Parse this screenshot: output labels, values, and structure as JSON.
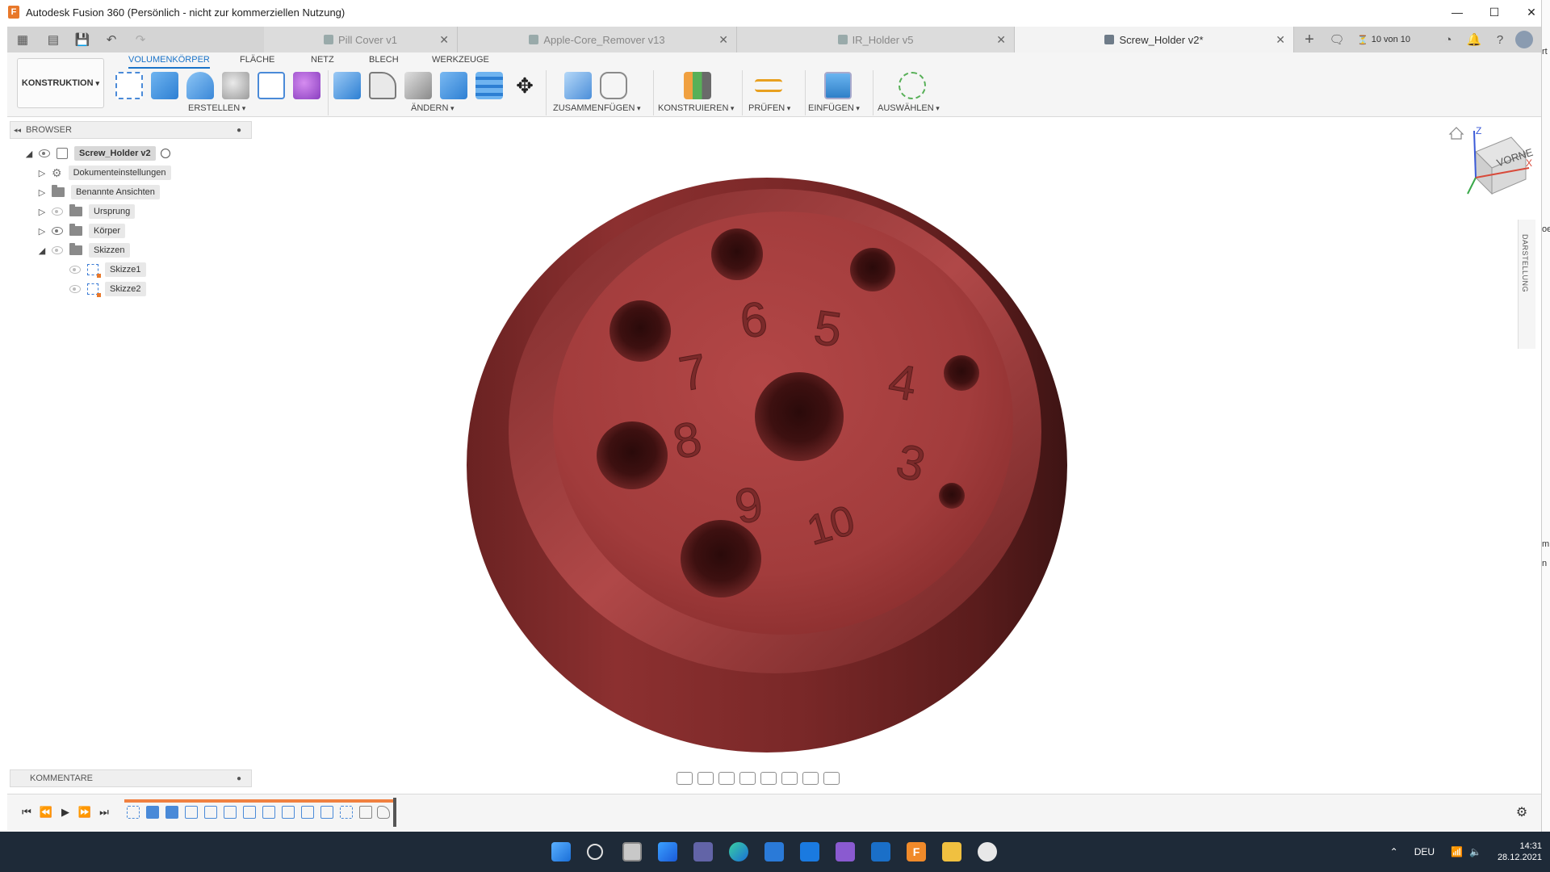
{
  "window": {
    "title": "Autodesk Fusion 360 (Persönlich - nicht zur kommerziellen Nutzung)",
    "logo_letter": "F"
  },
  "tabs": [
    {
      "label": "Pill Cover v1",
      "active": false
    },
    {
      "label": "Apple-Core_Remover v13",
      "active": false
    },
    {
      "label": "IR_Holder v5",
      "active": false
    },
    {
      "label": "Screw_Holder v2*",
      "active": true
    }
  ],
  "tabbar": {
    "job_count": "10 von 10"
  },
  "toolbar": {
    "workspace": "KONSTRUKTION",
    "ribbon_tabs": [
      "VOLUMENKÖRPER",
      "FLÄCHE",
      "NETZ",
      "BLECH",
      "WERKZEUGE"
    ],
    "groups": [
      "ERSTELLEN",
      "ÄNDERN",
      "ZUSAMMENFÜGEN",
      "KONSTRUIEREN",
      "PRÜFEN",
      "EINFÜGEN",
      "AUSWÄHLEN"
    ]
  },
  "browser": {
    "title": "BROWSER",
    "root": "Screw_Holder v2",
    "items": [
      {
        "label": "Dokumenteinstellungen",
        "icon": "gear-icon"
      },
      {
        "label": "Benannte Ansichten",
        "icon": "folder-icon"
      },
      {
        "label": "Ursprung",
        "icon": "folder-icon"
      },
      {
        "label": "Körper",
        "icon": "folder-icon"
      },
      {
        "label": "Skizzen",
        "icon": "folder-icon"
      }
    ],
    "sketches": [
      "Skizze1",
      "Skizze2"
    ]
  },
  "viewcube": {
    "face": "VORNE",
    "axis_z": "Z",
    "axis_x": "X"
  },
  "side_panel": {
    "label": "DARSTELLUNG"
  },
  "comments": {
    "title": "KOMMENTARE"
  },
  "model": {
    "color": "#a83a3a",
    "hole_labels": [
      "7",
      "6",
      "5",
      "4",
      "8",
      "3",
      "9",
      "10"
    ]
  },
  "taskbar": {
    "language": "DEU",
    "time": "14:31",
    "date": "28.12.2021"
  },
  "right_edge": {
    "fragments": [
      "rt",
      "oe",
      "m",
      "n"
    ]
  }
}
